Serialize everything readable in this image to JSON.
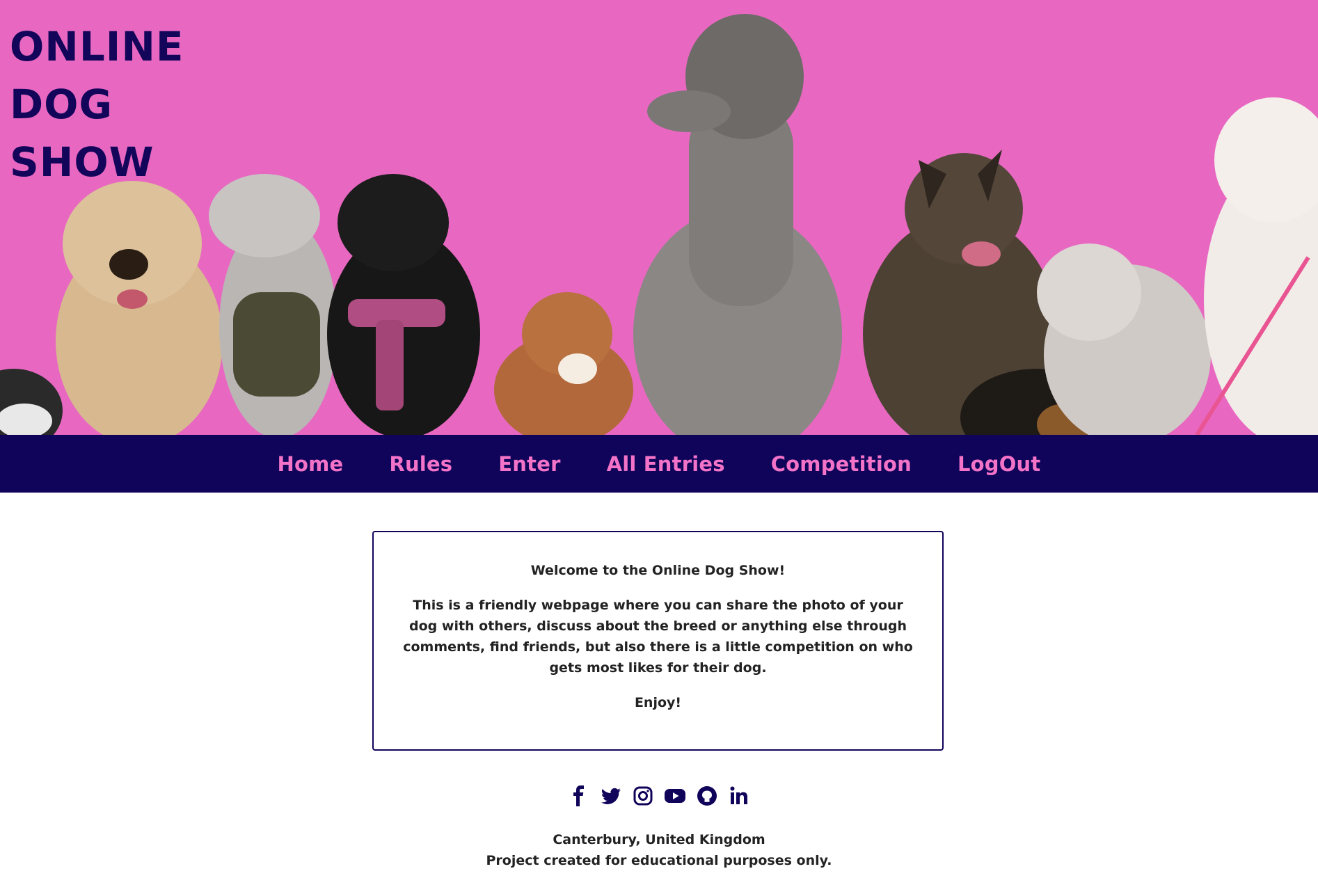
{
  "header": {
    "title_lines": [
      "ONLINE",
      "DOG",
      "SHOW"
    ]
  },
  "nav": {
    "items": [
      {
        "label": "Home"
      },
      {
        "label": "Rules"
      },
      {
        "label": "Enter"
      },
      {
        "label": "All Entries"
      },
      {
        "label": "Competition"
      },
      {
        "label": "LogOut"
      }
    ]
  },
  "welcome": {
    "heading": "Welcome to the Online Dog Show!",
    "body": "This is a friendly webpage where you can share the photo of your dog with others, discuss about the breed or anything else through comments, find friends, but also there is a little competition on who gets most likes for their dog.",
    "closing": "Enjoy!"
  },
  "social": {
    "icons": [
      "facebook-icon",
      "twitter-icon",
      "instagram-icon",
      "youtube-icon",
      "github-icon",
      "linkedin-icon"
    ]
  },
  "footer": {
    "location": "Canterbury, United Kingdom",
    "note": "Project created for educational purposes only."
  },
  "colors": {
    "brand_dark": "#10035a",
    "brand_pink": "#f273c8",
    "wall_pink": "#ec6cc4"
  }
}
